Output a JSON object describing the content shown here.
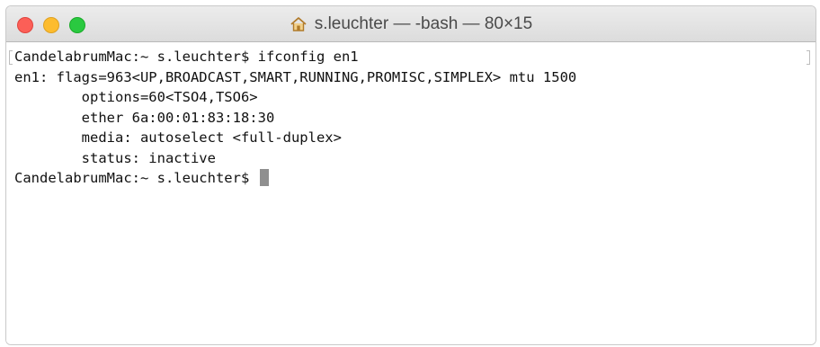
{
  "window": {
    "title": "s.leuchter — -bash — 80×15",
    "title_icon": "home-icon",
    "buttons": {
      "close_color": "#fc5f57",
      "minimize_color": "#fdbc2e",
      "zoom_color": "#2ac940"
    }
  },
  "terminal": {
    "lines": [
      "CandelabrumMac:~ s.leuchter$ ifconfig en1",
      "en1: flags=963<UP,BROADCAST,SMART,RUNNING,PROMISC,SIMPLEX> mtu 1500",
      "        options=60<TSO4,TSO6>",
      "        ether 6a:00:01:83:18:30",
      "        media: autoselect <full-duplex>",
      "        status: inactive",
      "CandelabrumMac:~ s.leuchter$ "
    ],
    "cursor_color": "#8f8f8f"
  }
}
